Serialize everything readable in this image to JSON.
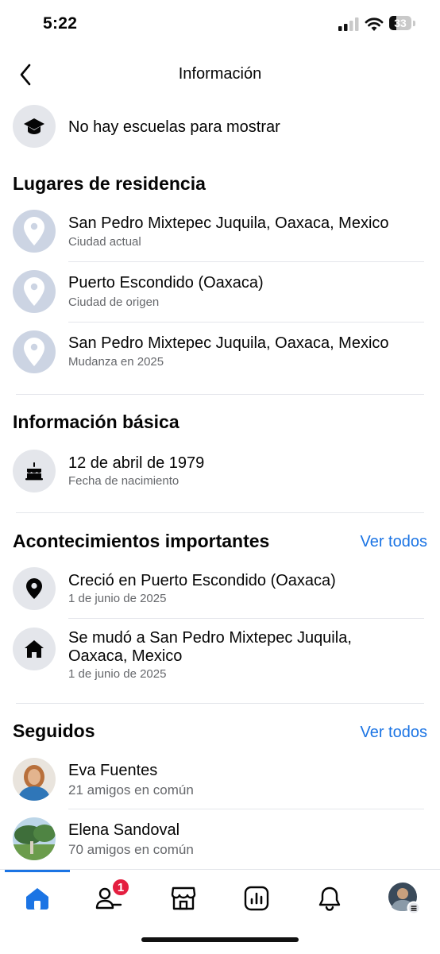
{
  "status_bar": {
    "time": "5:22",
    "battery": "33"
  },
  "header": {
    "title": "Información"
  },
  "education": {
    "text": "No hay escuelas para mostrar"
  },
  "residence": {
    "title": "Lugares de residencia",
    "items": [
      {
        "place": "San Pedro Mixtepec Juquila, Oaxaca, Mexico",
        "label": "Ciudad actual"
      },
      {
        "place": "Puerto Escondido (Oaxaca)",
        "label": "Ciudad de origen"
      },
      {
        "place": "San Pedro Mixtepec Juquila, Oaxaca, Mexico",
        "label": "Mudanza en 2025"
      }
    ]
  },
  "basic_info": {
    "title": "Información básica",
    "birthday": {
      "value": "12 de abril de 1979",
      "label": "Fecha de nacimiento"
    }
  },
  "life_events": {
    "title": "Acontecimientos importantes",
    "see_all": "Ver todos",
    "items": [
      {
        "line1": "Creció en Puerto Escondido (Oaxaca)",
        "date": "1 de junio de 2025"
      },
      {
        "line1": "Se mudó a San Pedro Mixtepec Juquila,",
        "line2": "Oaxaca, Mexico",
        "date": "1 de junio de 2025"
      }
    ]
  },
  "following": {
    "title": "Seguidos",
    "see_all": "Ver todos",
    "items": [
      {
        "name": "Eva Fuentes",
        "mutual": "21 amigos en común"
      },
      {
        "name": "Elena Sandoval",
        "mutual": "70 amigos en común"
      }
    ]
  },
  "tabbar": {
    "friends_badge": "1",
    "tabs": [
      "home-icon",
      "friends-icon",
      "marketplace-icon",
      "dashboard-icon",
      "bell-icon",
      "profile-avatar"
    ]
  },
  "colors": {
    "accent": "#1b74e4",
    "badge": "#e41e3f",
    "pin_bg": "#ccd4e3"
  }
}
